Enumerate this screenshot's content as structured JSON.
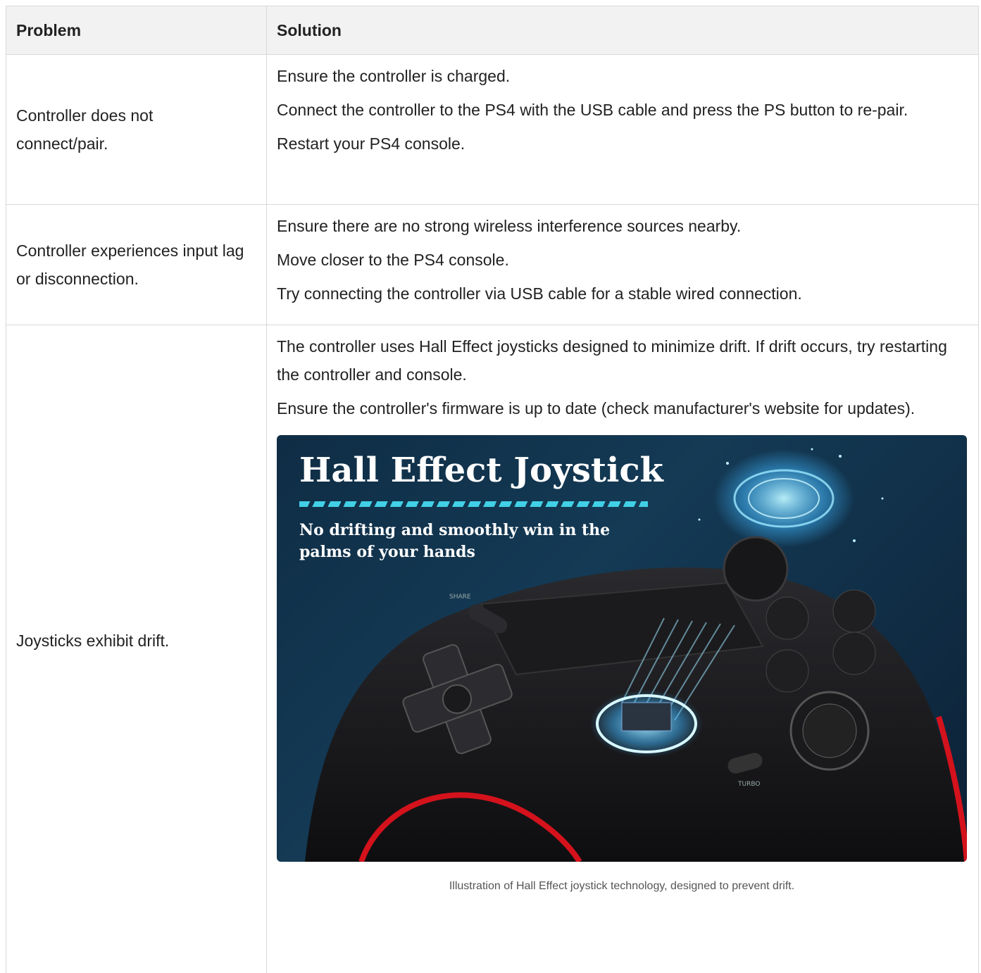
{
  "table": {
    "headers": [
      "Problem",
      "Solution"
    ],
    "rows": [
      {
        "problem": "Controller does not connect/pair.",
        "solutions": [
          "Ensure the controller is charged.",
          "Connect the controller to the PS4 with the USB cable and press the PS button to re-pair.",
          "Restart your PS4 console."
        ]
      },
      {
        "problem": "Controller experiences input lag or disconnection.",
        "solutions": [
          "Ensure there are no strong wireless interference sources nearby.",
          "Move closer to the PS4 console.",
          "Try connecting the controller via USB cable for a stable wired connection."
        ]
      },
      {
        "problem": "Joysticks exhibit drift.",
        "solutions": [
          "The controller uses Hall Effect joysticks designed to minimize drift. If drift occurs, try restarting the controller and console.",
          "Ensure the controller's firmware is up to date (check manufacturer's website for updates)."
        ],
        "figure": {
          "title": "Hall Effect Joystick",
          "subtitle": "No drifting and smoothly win in the palms of your hands",
          "labels": [
            "SHARE",
            "TURBO"
          ],
          "caption": "Illustration of Hall Effect joystick technology, designed to prevent drift."
        }
      }
    ]
  }
}
